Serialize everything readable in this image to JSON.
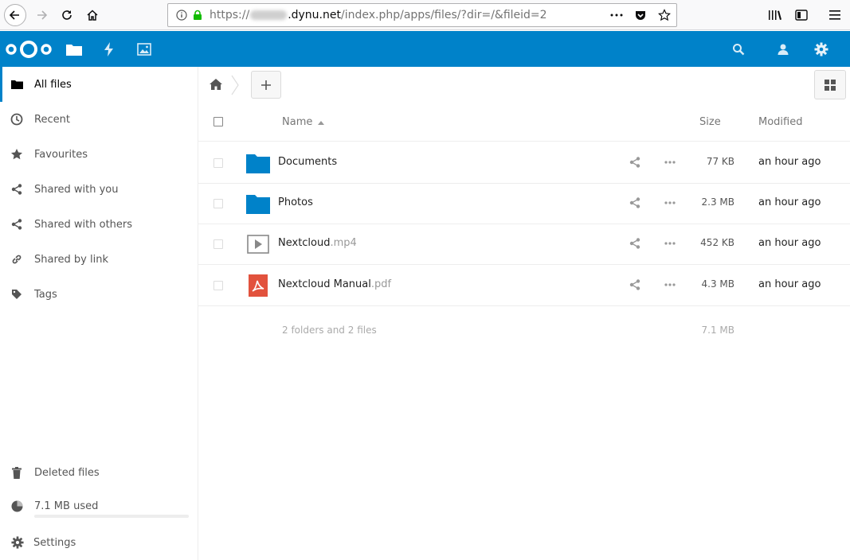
{
  "browser": {
    "url_prefix": "https://",
    "url_host": ".dynu.net",
    "url_path": "/index.php/apps/files/?dir=/&fileid=2"
  },
  "colors": {
    "brand": "#0082c9",
    "pdf": "#e2523d",
    "folder": "#0082c9"
  },
  "sidebar": {
    "items": [
      {
        "label": "All files",
        "icon": "folder-icon"
      },
      {
        "label": "Recent",
        "icon": "clock-icon"
      },
      {
        "label": "Favourites",
        "icon": "star-icon"
      },
      {
        "label": "Shared with you",
        "icon": "share-icon"
      },
      {
        "label": "Shared with others",
        "icon": "share-icon"
      },
      {
        "label": "Shared by link",
        "icon": "link-icon"
      },
      {
        "label": "Tags",
        "icon": "tag-icon"
      }
    ],
    "deleted": "Deleted files",
    "quota": "7.1 MB used",
    "quota_fraction": 0.0,
    "settings": "Settings"
  },
  "table": {
    "headers": {
      "name": "Name",
      "size": "Size",
      "modified": "Modified"
    },
    "rows": [
      {
        "name": "Documents",
        "ext": "",
        "type": "folder",
        "size": "77 KB",
        "modified": "an hour ago"
      },
      {
        "name": "Photos",
        "ext": "",
        "type": "folder",
        "size": "2.3 MB",
        "modified": "an hour ago"
      },
      {
        "name": "Nextcloud",
        "ext": ".mp4",
        "type": "video",
        "size": "452 KB",
        "modified": "an hour ago"
      },
      {
        "name": "Nextcloud Manual",
        "ext": ".pdf",
        "type": "pdf",
        "size": "4.3 MB",
        "modified": "an hour ago"
      }
    ],
    "summary": "2 folders and 2 files",
    "summary_size": "7.1 MB"
  }
}
